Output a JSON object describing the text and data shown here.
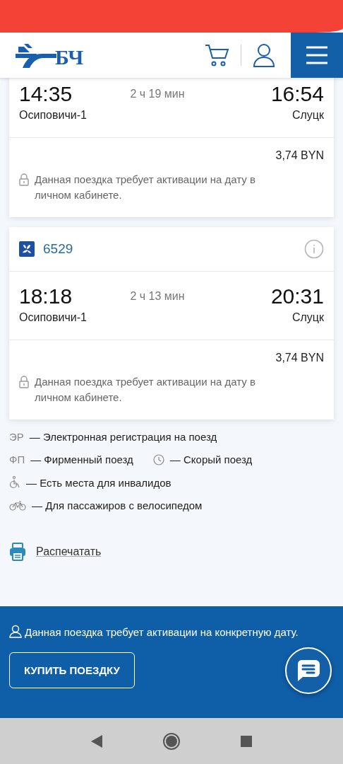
{
  "header": {
    "logo_text": "БЧ"
  },
  "trips": [
    {
      "depart": "14:35",
      "duration": "2 ч 19 мин",
      "arrive": "16:54",
      "from": "Осиповичи-1",
      "to": "Слуцк",
      "price": "3,74 BYN",
      "note": "Данная поездка требует активации на дату в личном кабинете."
    },
    {
      "number": "6529",
      "depart": "18:18",
      "duration": "2 ч 13 мин",
      "arrive": "20:31",
      "from": "Осиповичи-1",
      "to": "Слуцк",
      "price": "3,74 BYN",
      "note": "Данная поездка требует активации на дату в личном кабинете."
    }
  ],
  "legend": [
    [
      {
        "kind": "code",
        "code": "ЭР",
        "text": "— Электронная регистрация на поезд"
      }
    ],
    [
      {
        "kind": "code",
        "code": "ФП",
        "text": "— Фирменный поезд"
      },
      {
        "kind": "clock",
        "text": "— Скорый поезд"
      }
    ],
    [
      {
        "kind": "wheelchair",
        "text": "— Есть места для инвалидов"
      }
    ],
    [
      {
        "kind": "bicycle",
        "text": "— Для пассажиров с велосипедом"
      }
    ]
  ],
  "print_link": "Распечатать",
  "footer": {
    "note": "Данная поездка требует активации на конкретную дату.",
    "button": "КУПИТЬ ПОЕЗДКУ"
  }
}
